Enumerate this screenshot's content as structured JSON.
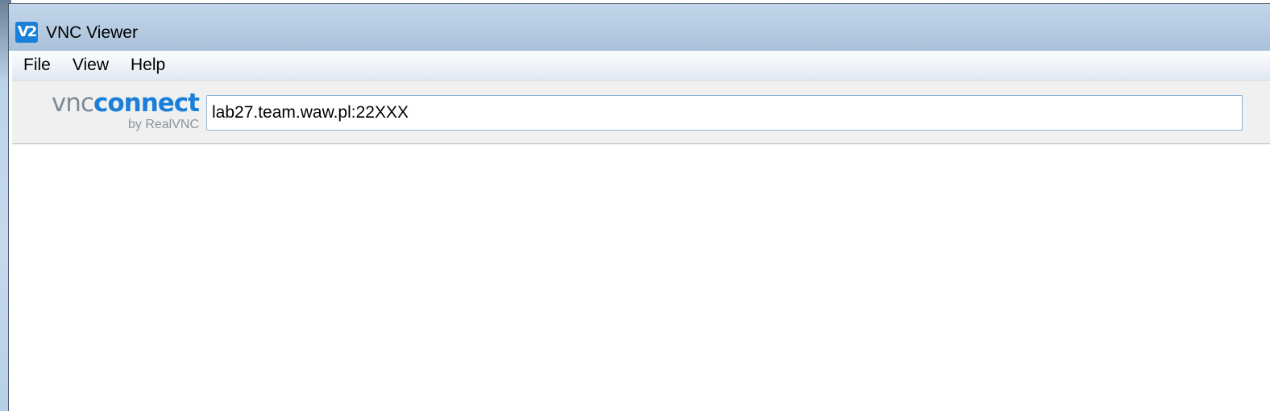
{
  "window": {
    "title": "VNC Viewer",
    "app_icon_text": "V2"
  },
  "menu": {
    "items": [
      "File",
      "View",
      "Help"
    ]
  },
  "toolbar": {
    "logo_vnc": "vnc",
    "logo_connect": "connect",
    "logo_sub": "by RealVNC",
    "address_value": "lab27.team.waw.pl:22XXX"
  },
  "colors": {
    "brand_blue": "#1a7fd8",
    "logo_gray": "#7e8a97"
  }
}
